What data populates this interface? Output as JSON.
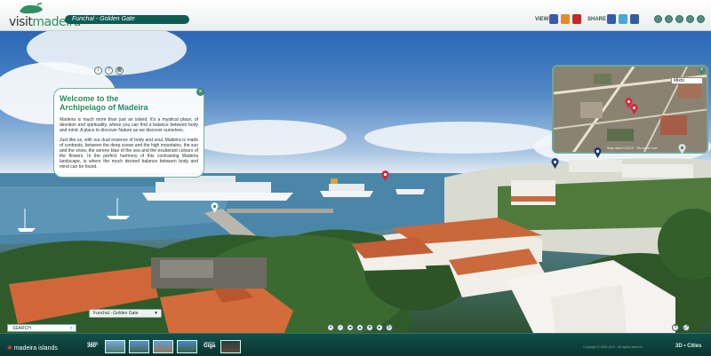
{
  "header": {
    "logo_text_1": "visit",
    "logo_text_2": "madeira",
    "location": "Funchal - Golden Gate",
    "view_label": "VIEW",
    "share_label": "SHARE",
    "view_icons": [
      "fullscreen-icon",
      "instagram-icon",
      "youtube-icon"
    ],
    "share_icons": [
      "delicious-icon",
      "twitter-icon",
      "facebook-icon"
    ]
  },
  "welcome": {
    "title_line1": "Welcome to the",
    "title_line2": "Archipelago of Madeira",
    "paragraph1": "Madeira is much more than just an island. It's a mystical place, of devotion and spirituality, where you can find a balance between body and mind. A place to discover Nature as we discover ourselves.",
    "paragraph2": "Just like us, with our dual essence of body and soul, Madeira is made of contrasts, between the deep ocean and the high mountains, the sun and the snow, the serene blue of the sea and the exuberant colours of the flowers. In the perfect harmony of this contrasting Madeira landscape, is where the much desired balance between body and mind can be found."
  },
  "map": {
    "mode": "Mixto",
    "footer": "Map data ©2013 · Terms of Use"
  },
  "location_select": "Funchal - Golden Gate",
  "search": {
    "placeholder": "SEARCH"
  },
  "footer": {
    "islands_brand": "madeira islands",
    "photos360_top": "photos",
    "photos360_bottom": "360°",
    "photosgiga_top": "photos",
    "photosgiga_bottom": "Giga",
    "copyright": "Copyright © 2006-2013 · All rights reserved",
    "brand_right": "3D • Cities"
  },
  "colors": {
    "brand_green": "#2b8a62",
    "bar_dark": "#0a332f",
    "pin_red": "#d9263b",
    "pin_navy": "#1f3c6e"
  }
}
